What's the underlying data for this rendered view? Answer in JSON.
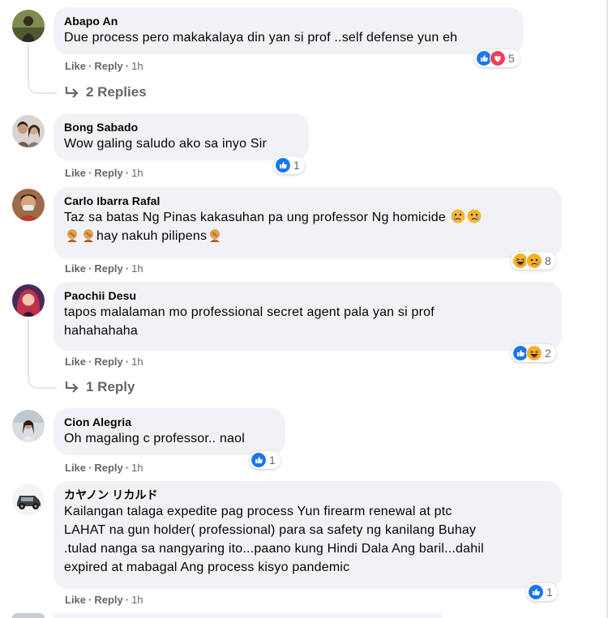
{
  "actions": {
    "like": "Like",
    "reply": "Reply",
    "separator": "·"
  },
  "comments": [
    {
      "author": "Abapo An",
      "lines": [
        "Due process pero makakalaya din yan si prof ..self defense yun eh"
      ],
      "time": "1h",
      "reactions": [
        "like",
        "love"
      ],
      "count": "5"
    },
    {
      "author": "Bong Sabado",
      "lines": [
        "Wow galing saludo ako sa inyo Sir"
      ],
      "time": "1h",
      "reactions": [
        "like"
      ],
      "count": "1"
    },
    {
      "author": "Carlo Ibarra Rafal",
      "lines": [
        "Taz sa batas Ng Pinas kakasuhan pa ung professor Ng homicide",
        "hay nakuh pilipens"
      ],
      "time": "1h",
      "reactions": [
        "haha",
        "sad"
      ],
      "count": "8"
    },
    {
      "author": "Paochii Desu",
      "lines": [
        "tapos malalaman mo professional secret agent pala yan si prof",
        "hahahahaha"
      ],
      "time": "1h",
      "reactions": [
        "like",
        "haha"
      ],
      "count": "2"
    },
    {
      "author": "Cion Alegria",
      "lines": [
        "Oh magaling c professor.. naol"
      ],
      "time": "1h",
      "reactions": [
        "like"
      ],
      "count": "1"
    },
    {
      "author": "カヤノン リカルド",
      "lines": [
        "Kailangan talaga expedite pag process Yun firearm renewal at ptc",
        "LAHAT na gun holder( professional) para sa safety ng kanilang Buhay",
        ".tulad nanga sa nangyaring ito...paano kung Hindi Dala Ang baril...dahil",
        "expired at mabagal Ang process kisyo pandemic"
      ],
      "time": "1h",
      "reactions": [
        "like"
      ],
      "count": "1"
    }
  ],
  "replies": [
    {
      "label": "2 Replies"
    },
    {
      "label": "1 Reply"
    }
  ],
  "colors": {
    "like": "#1877f2",
    "love": "#f33e58",
    "bubble": "#f0f2f5",
    "meta": "#65676b"
  }
}
